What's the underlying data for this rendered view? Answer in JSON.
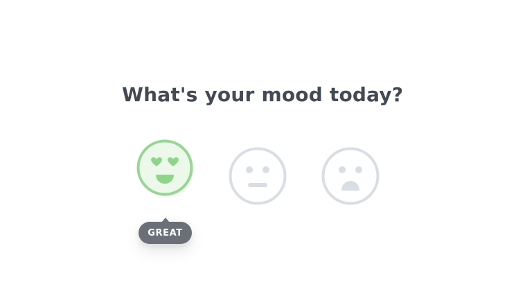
{
  "question": "What's your mood today?",
  "moods": [
    {
      "id": "great",
      "label": "GREAT",
      "selected": true
    },
    {
      "id": "neutral",
      "selected": false
    },
    {
      "id": "sad",
      "selected": false
    }
  ],
  "tooltip": {
    "label": "GREAT"
  },
  "colors": {
    "heading": "#434a54",
    "selected_outline": "#9ad497",
    "selected_fill": "#ecf8ea",
    "selected_features": "#8fd48a",
    "unselected_outline": "#d8dee3",
    "unselected_features": "#d8dee3",
    "tooltip_bg": "#6b7078",
    "tooltip_text": "#ffffff"
  }
}
